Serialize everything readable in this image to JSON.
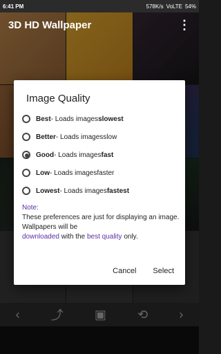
{
  "status": {
    "time": "6:41 PM",
    "speed": "578K/s",
    "network": "VoLTE",
    "battery": "54%"
  },
  "appbar": {
    "title": "3D HD Wallpaper",
    "menu_icon": "more-vert-icon"
  },
  "dialog": {
    "title": "Image Quality",
    "options": [
      {
        "name": "Best",
        "desc": " - Loads images ",
        "emph": "slowest",
        "checked": false
      },
      {
        "name": "Better",
        "desc": " - Loads images ",
        "emph": "slow",
        "checked": false
      },
      {
        "name": "Good",
        "desc": " - Loads images ",
        "emph": "fast",
        "checked": true
      },
      {
        "name": "Low",
        "desc": " - Loads images ",
        "emph": "faster",
        "checked": false
      },
      {
        "name": "Lowest",
        "desc": " - Loads images ",
        "emph": "fastest",
        "checked": false
      }
    ],
    "note_label": "Note:",
    "note_text1": "These preferences are just for displaying an image. Wallpapers will be",
    "note_link1": "downloaded",
    "note_text2": " with the ",
    "note_link2": "best quality",
    "note_text3": " only.",
    "cancel": "Cancel",
    "select": "Select"
  },
  "bottom_icons": [
    "chevron-left-icon",
    "share-icon",
    "image-icon",
    "rotate-icon",
    "chevron-right-icon"
  ],
  "colors": {
    "accent": "#5b2ea6"
  }
}
